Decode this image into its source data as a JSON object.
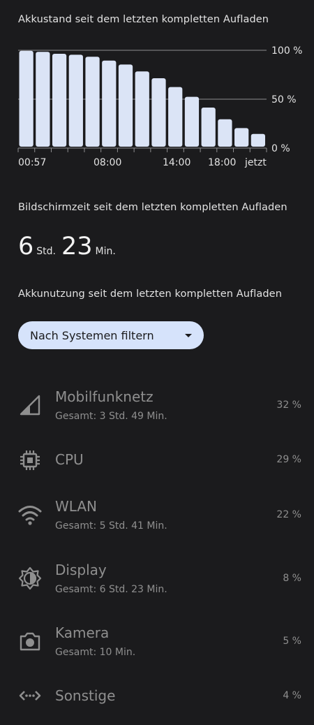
{
  "battery_header": "Akkustand seit dem letzten kompletten Aufladen",
  "chart_data": {
    "type": "bar",
    "x_tick_labels": [
      "00:57",
      "08:00",
      "14:00",
      "18:00",
      "jetzt"
    ],
    "y_tick_labels": [
      "100 %",
      "50 %",
      "0 %"
    ],
    "values": [
      98,
      97,
      95,
      94,
      92,
      88,
      84,
      77,
      70,
      61,
      51,
      40,
      28,
      19,
      13
    ],
    "ylim": [
      0,
      100
    ],
    "bar_color": "#dbe4f6",
    "grid": true
  },
  "screen_time": {
    "header": "Bildschirmzeit seit dem letzten kompletten Aufladen",
    "hours": "6",
    "hours_unit": "Std.",
    "minutes": "23",
    "minutes_unit": "Min."
  },
  "usage_header": "Akkunutzung seit dem letzten kompletten Aufladen",
  "filter": {
    "label": "Nach Systemen filtern"
  },
  "usage_items": [
    {
      "title": "Mobilfunknetz",
      "subtitle": "Gesamt: 3 Std. 49 Min.",
      "percent": "32 %",
      "icon": "signal-icon"
    },
    {
      "title": "CPU",
      "subtitle": "",
      "percent": "29 %",
      "icon": "cpu-icon"
    },
    {
      "title": "WLAN",
      "subtitle": "Gesamt: 5 Std. 41 Min.",
      "percent": "22 %",
      "icon": "wifi-icon"
    },
    {
      "title": "Display",
      "subtitle": "Gesamt: 6 Std. 23 Min.",
      "percent": "8 %",
      "icon": "brightness-icon"
    },
    {
      "title": "Kamera",
      "subtitle": "Gesamt: 10 Min.",
      "percent": "5 %",
      "icon": "camera-icon"
    },
    {
      "title": "Sonstige",
      "subtitle": "",
      "percent": "4 %",
      "icon": "code-icon"
    }
  ]
}
